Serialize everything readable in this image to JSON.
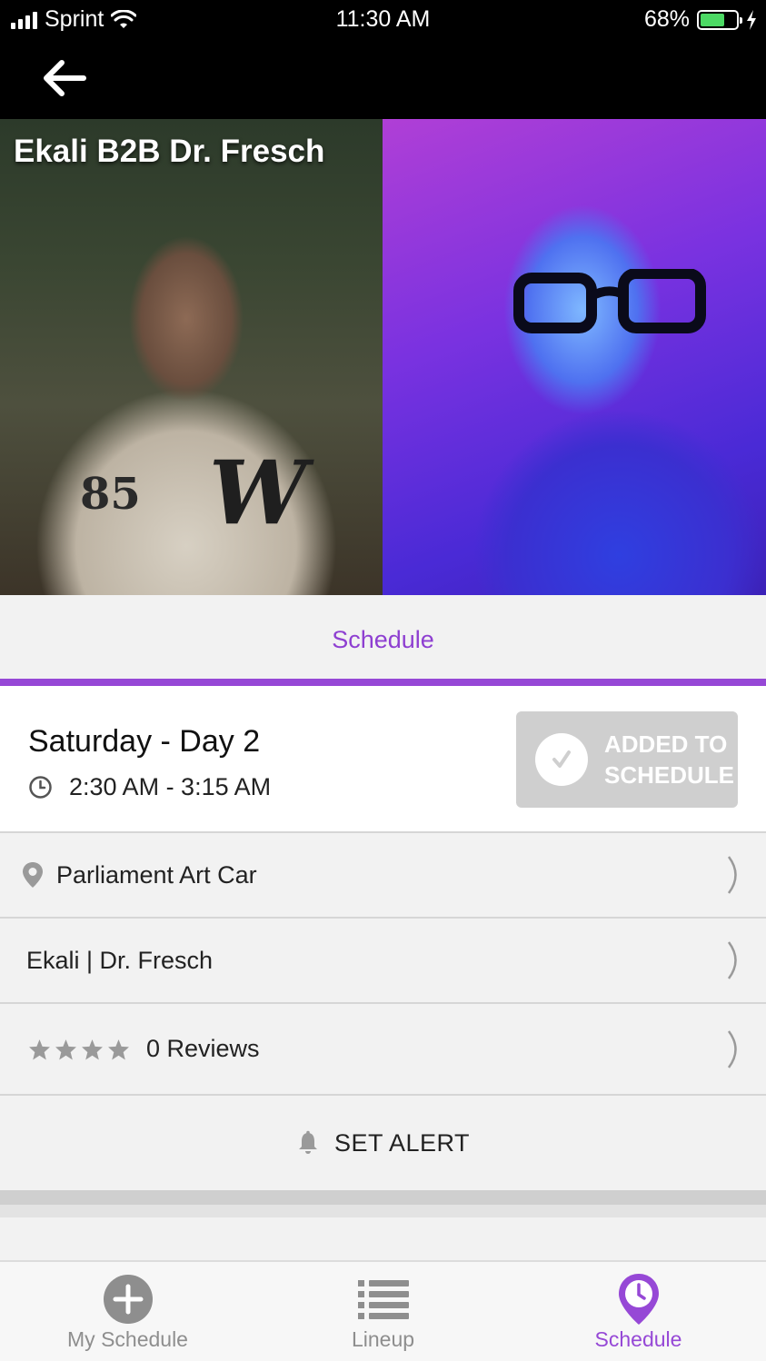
{
  "status_bar": {
    "carrier": "Sprint",
    "time": "11:30 AM",
    "battery_percent": "68%",
    "battery_level": 0.68
  },
  "artist": {
    "title": "Ekali B2B Dr. Fresch"
  },
  "tabs": [
    {
      "label": "Schedule",
      "active": true
    }
  ],
  "session": {
    "day": "Saturday - Day 2",
    "time_range": "2:30 AM - 3:15 AM",
    "added_label": "ADDED TO SCHEDULE"
  },
  "rows": {
    "venue": "Parliament Art Car",
    "artists": "Ekali | Dr. Fresch",
    "reviews": "0 Reviews",
    "rating": 0
  },
  "alert": {
    "label": "SET ALERT"
  },
  "bottom_nav": [
    {
      "label": "My Schedule",
      "icon": "plus-circle-icon",
      "active": false
    },
    {
      "label": "Lineup",
      "icon": "list-icon",
      "active": false
    },
    {
      "label": "Schedule",
      "icon": "clock-pin-icon",
      "active": true
    }
  ],
  "colors": {
    "accent": "#9648d6",
    "added_button": "#cfcfcf",
    "battery": "#4cd964"
  }
}
